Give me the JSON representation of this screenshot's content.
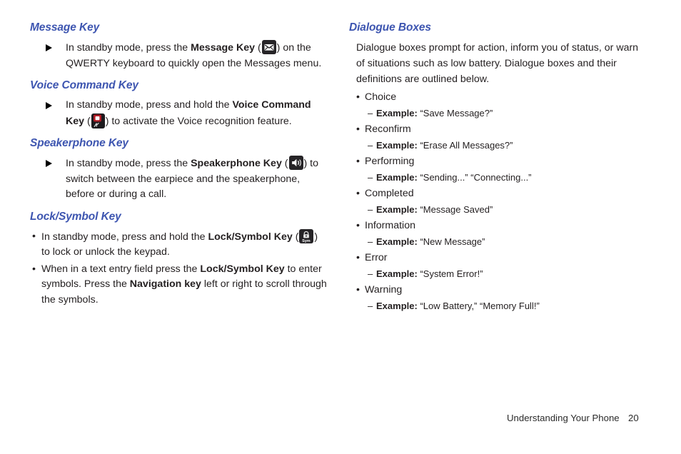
{
  "left_column": {
    "sections": [
      {
        "heading": "Message Key",
        "list_type": "triangle",
        "items": [
          {
            "pre": "In standby mode, press the ",
            "bold": "Message Key",
            "icon": "envelope-icon",
            "post": ") on the QWERTY keyboard to quickly open the Messages menu.",
            "paren_open": " ("
          }
        ]
      },
      {
        "heading": "Voice Command Key",
        "list_type": "triangle",
        "items": [
          {
            "pre": "In standby mode, press and hold the ",
            "bold": "Voice Command Key",
            "icon": "voice-command-icon",
            "post": ") to activate the Voice recognition feature.",
            "paren_open": " ("
          }
        ]
      },
      {
        "heading": "Speakerphone Key",
        "list_type": "triangle",
        "items": [
          {
            "pre": "In standby mode, press the ",
            "bold": "Speakerphone Key",
            "icon": "speakerphone-icon",
            "post": ") to switch between the earpiece and the speakerphone, before or during a call.",
            "paren_open": " ("
          }
        ]
      },
      {
        "heading": "Lock/Symbol Key",
        "list_type": "dot",
        "items": [
          {
            "pre": "In standby mode, press and hold the ",
            "bold": "Lock/Symbol Key",
            "icon": "lock-symbol-icon",
            "post": ") to lock or unlock the keypad.",
            "paren_open": " ("
          },
          {
            "pre": "When in a text entry field press the ",
            "bold": "Lock/Symbol Key",
            "mid": " to enter symbols. Press the ",
            "bold2": "Navigation key",
            "post": " left or right to scroll through the symbols."
          }
        ]
      }
    ]
  },
  "right_column": {
    "heading": "Dialogue Boxes",
    "intro": "Dialogue boxes prompt for action, inform you of status, or warn of situations such as low battery. Dialogue boxes and their definitions are outlined below.",
    "bullet_char": "•",
    "dash_char": "–",
    "example_label": "Example:",
    "entries": [
      {
        "name": "Choice",
        "example": "“Save Message?”"
      },
      {
        "name": "Reconfirm",
        "example": "“Erase All Messages?”"
      },
      {
        "name": "Performing",
        "example": "“Sending...” “Connecting...”"
      },
      {
        "name": "Completed",
        "example": "“Message Saved”"
      },
      {
        "name": "Information",
        "example": "“New Message”"
      },
      {
        "name": "Error",
        "example": "“System Error!”"
      },
      {
        "name": "Warning",
        "example": "“Low Battery,” “Memory Full!”"
      }
    ]
  },
  "footer": {
    "title": "Understanding Your Phone",
    "page_number": "20"
  },
  "colors": {
    "heading_blue": "#3d55b0",
    "body_text": "#231f20",
    "key_icon_bg": "#262427",
    "voice_accent_red": "#b01b24"
  },
  "icons": {
    "envelope": "envelope-icon",
    "voice_command": "voice-command-icon",
    "speakerphone": "speakerphone-icon",
    "lock_symbol": "lock-symbol-icon",
    "triangle_bullet": "triangle-bullet-icon"
  }
}
